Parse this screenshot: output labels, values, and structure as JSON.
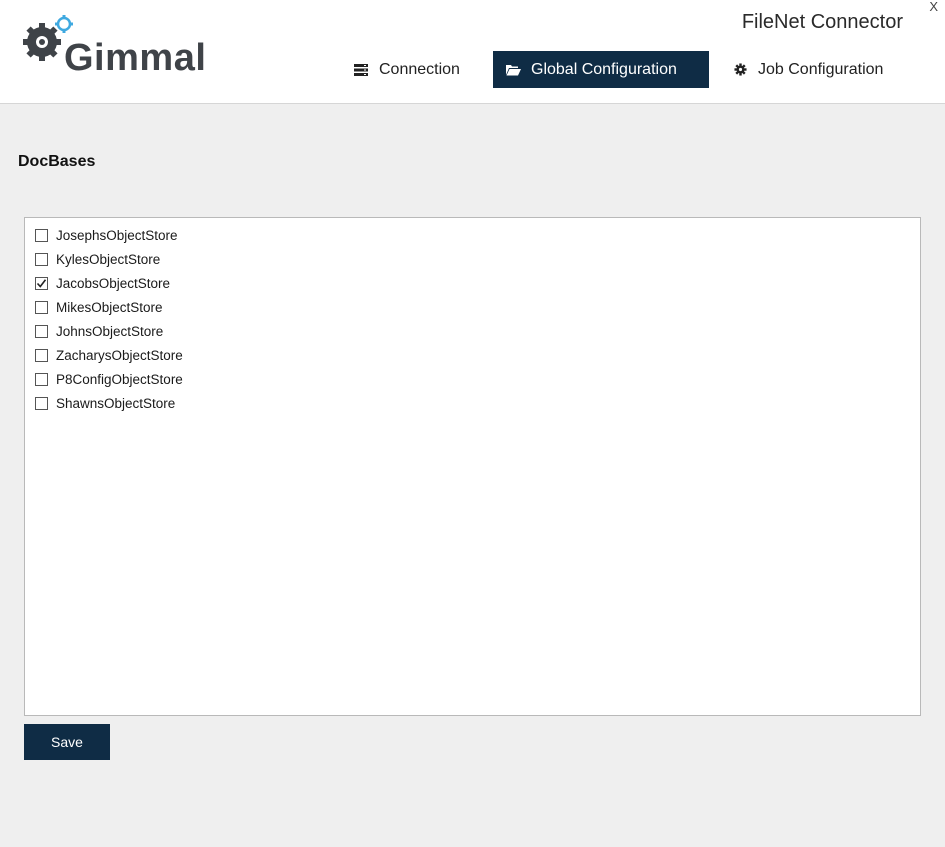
{
  "header": {
    "logo_text": "Gimmal",
    "app_title": "FileNet Connector",
    "close_label": "X"
  },
  "nav": {
    "tabs": [
      {
        "label": "Connection",
        "icon": "server-icon",
        "active": false
      },
      {
        "label": "Global Configuration",
        "icon": "folder-open-icon",
        "active": true
      },
      {
        "label": "Job Configuration",
        "icon": "gear-icon",
        "active": false
      }
    ]
  },
  "main": {
    "section_title": "DocBases",
    "docbases": [
      {
        "label": "JosephsObjectStore",
        "checked": false
      },
      {
        "label": "KylesObjectStore",
        "checked": false
      },
      {
        "label": "JacobsObjectStore",
        "checked": true
      },
      {
        "label": "MikesObjectStore",
        "checked": false
      },
      {
        "label": "JohnsObjectStore",
        "checked": false
      },
      {
        "label": "ZacharysObjectStore",
        "checked": false
      },
      {
        "label": "P8ConfigObjectStore",
        "checked": false
      },
      {
        "label": "ShawnsObjectStore",
        "checked": false
      }
    ],
    "save_label": "Save"
  },
  "colors": {
    "accent": "#0f2c45",
    "background": "#efefef",
    "header_bg": "#ffffff"
  }
}
